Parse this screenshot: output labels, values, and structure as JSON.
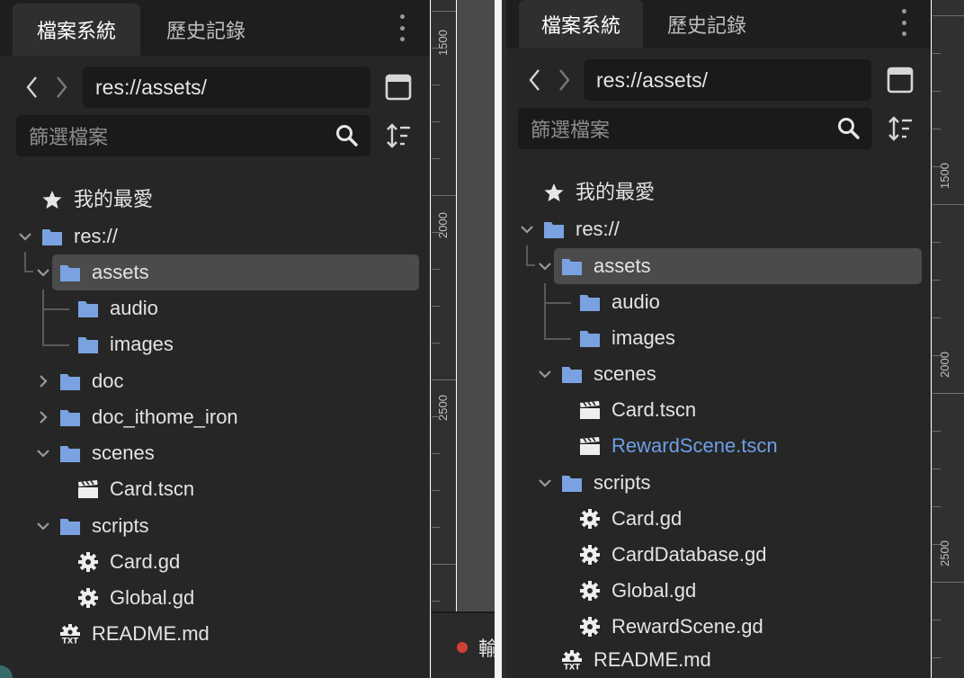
{
  "colors": {
    "panel_bg": "#262626",
    "tab_bar_bg": "#1e1e1e",
    "input_bg": "#1a1a1a",
    "selected_row_bg": "#4b4b4b",
    "folder_icon": "#7aa2e0",
    "highlight_text": "#6e9fe8",
    "text": "#e4e4e4"
  },
  "left_panel": {
    "tabs": [
      {
        "label": "檔案系統"
      },
      {
        "label": "歷史記錄"
      }
    ],
    "path": "res://assets/",
    "filter_placeholder": "篩選檔案",
    "tree": [
      {
        "label": "我的最愛",
        "icon": "star-icon"
      },
      {
        "label": "res://",
        "icon": "folder-icon",
        "chevron": "expanded"
      },
      {
        "label": "assets",
        "icon": "folder-icon",
        "chevron": "expanded",
        "selected": true
      },
      {
        "label": "audio",
        "icon": "folder-icon"
      },
      {
        "label": "images",
        "icon": "folder-icon"
      },
      {
        "label": "doc",
        "icon": "folder-icon",
        "chevron": "collapsed"
      },
      {
        "label": "doc_ithome_iron",
        "icon": "folder-icon",
        "chevron": "collapsed"
      },
      {
        "label": "scenes",
        "icon": "folder-icon",
        "chevron": "expanded"
      },
      {
        "label": "Card.tscn",
        "icon": "clapperboard-icon"
      },
      {
        "label": "scripts",
        "icon": "folder-icon",
        "chevron": "expanded"
      },
      {
        "label": "Card.gd",
        "icon": "gear-icon"
      },
      {
        "label": "Global.gd",
        "icon": "gear-icon"
      },
      {
        "label": "README.md",
        "icon": "txt-file-icon"
      }
    ],
    "ruler_labels": [
      "1500",
      "2000",
      "2500"
    ]
  },
  "bottom_bar": {
    "text": "輸"
  },
  "right_panel": {
    "tabs": [
      {
        "label": "檔案系統"
      },
      {
        "label": "歷史記錄"
      }
    ],
    "path": "res://assets/",
    "filter_placeholder": "篩選檔案",
    "tree": [
      {
        "label": "我的最愛",
        "icon": "star-icon"
      },
      {
        "label": "res://",
        "icon": "folder-icon",
        "chevron": "expanded"
      },
      {
        "label": "assets",
        "icon": "folder-icon",
        "chevron": "expanded",
        "selected": true
      },
      {
        "label": "audio",
        "icon": "folder-icon"
      },
      {
        "label": "images",
        "icon": "folder-icon"
      },
      {
        "label": "scenes",
        "icon": "folder-icon",
        "chevron": "expanded"
      },
      {
        "label": "Card.tscn",
        "icon": "clapperboard-icon"
      },
      {
        "label": "RewardScene.tscn",
        "icon": "clapperboard-icon",
        "highlight": true
      },
      {
        "label": "scripts",
        "icon": "folder-icon",
        "chevron": "expanded"
      },
      {
        "label": "Card.gd",
        "icon": "gear-icon"
      },
      {
        "label": "CardDatabase.gd",
        "icon": "gear-icon"
      },
      {
        "label": "Global.gd",
        "icon": "gear-icon"
      },
      {
        "label": "RewardScene.gd",
        "icon": "gear-icon"
      },
      {
        "label": "README.md",
        "icon": "txt-file-icon"
      }
    ],
    "ruler_labels": [
      "1500",
      "2000",
      "2500"
    ]
  }
}
